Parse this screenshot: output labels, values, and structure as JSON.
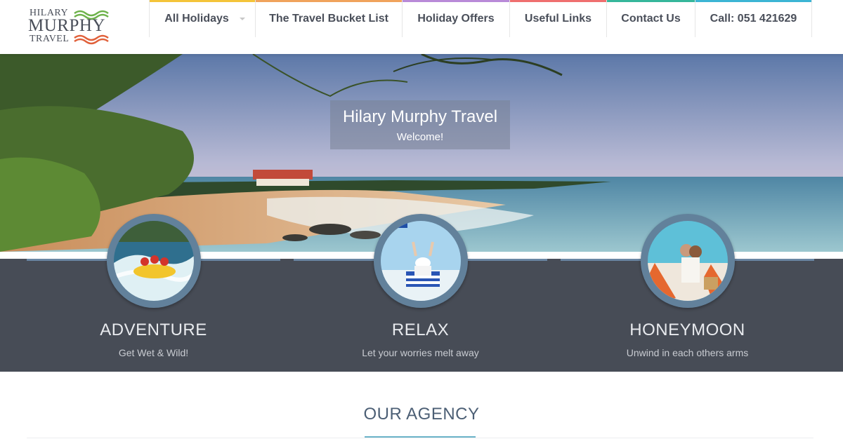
{
  "logo": {
    "line1": "HILARY",
    "line2": "MURPHY",
    "line3": "TRAVEL"
  },
  "nav": [
    {
      "label": "All Holidays",
      "color": "#f4c43a",
      "dropdown": true
    },
    {
      "label": "The Travel Bucket List",
      "color": "#f0a35c",
      "dropdown": false
    },
    {
      "label": "Holiday Offers",
      "color": "#b98ad8",
      "dropdown": false
    },
    {
      "label": "Useful Links",
      "color": "#ef6f6f",
      "dropdown": false
    },
    {
      "label": "Contact Us",
      "color": "#36b79b",
      "dropdown": false
    },
    {
      "label": "Call: 051 421629",
      "color": "#3cb5d4",
      "dropdown": false
    }
  ],
  "hero": {
    "title": "Hilary Murphy Travel",
    "subtitle": "Welcome!"
  },
  "features": [
    {
      "title": "ADVENTURE",
      "subtitle": "Get Wet & Wild!"
    },
    {
      "title": "RELAX",
      "subtitle": "Let your worries melt away"
    },
    {
      "title": "HONEYMOON",
      "subtitle": "Unwind in each others arms"
    }
  ],
  "agency": {
    "title": "OUR AGENCY"
  },
  "colors": {
    "band": "#474c56",
    "accent": "#6a86a3",
    "agency_underline": "#6bb3c9"
  }
}
